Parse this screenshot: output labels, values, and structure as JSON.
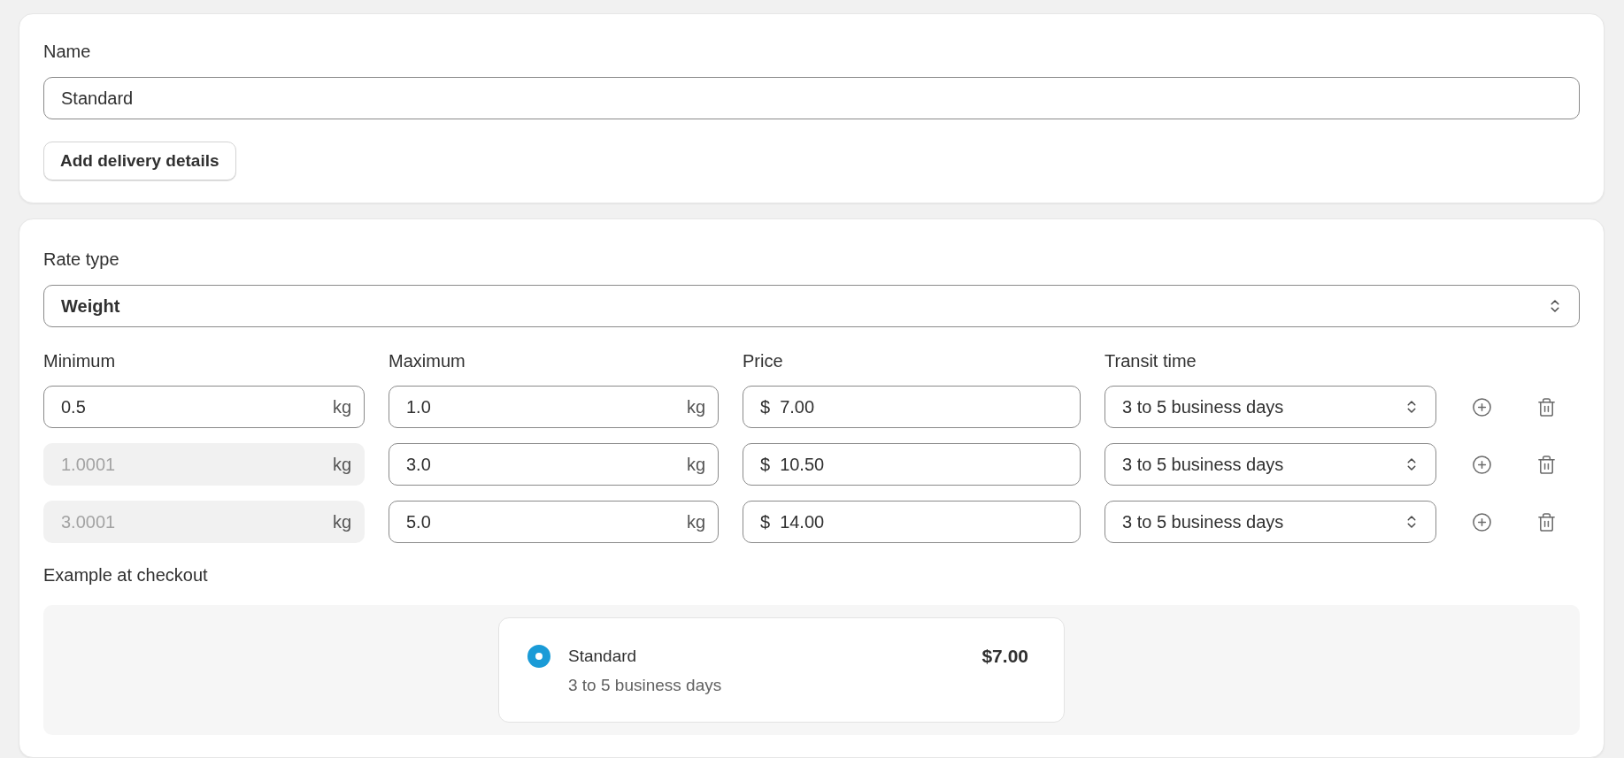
{
  "name_section": {
    "label": "Name",
    "value": "Standard",
    "button": "Add delivery details"
  },
  "rate_section": {
    "label": "Rate type",
    "value": "Weight",
    "columns": [
      "Minimum",
      "Maximum",
      "Price",
      "Transit time"
    ],
    "rows": [
      {
        "minimum": {
          "value": "0.5",
          "unit": "kg",
          "disabled": false
        },
        "maximum": {
          "value": "1.0",
          "unit": "kg"
        },
        "price": {
          "currency": "$",
          "value": "7.00"
        },
        "transit": "3 to 5 business days"
      },
      {
        "minimum": {
          "value": "1.0001",
          "unit": "kg",
          "disabled": true
        },
        "maximum": {
          "value": "3.0",
          "unit": "kg"
        },
        "price": {
          "currency": "$",
          "value": "10.50"
        },
        "transit": "3 to 5 business days"
      },
      {
        "minimum": {
          "value": "3.0001",
          "unit": "kg",
          "disabled": true
        },
        "maximum": {
          "value": "5.0",
          "unit": "kg"
        },
        "price": {
          "currency": "$",
          "value": "14.00"
        },
        "transit": "3 to 5 business days"
      }
    ]
  },
  "checkout_example": {
    "label": "Example at checkout",
    "option": {
      "name": "Standard",
      "detail": "3 to 5 business days",
      "price": "$7.00",
      "selected": true
    }
  }
}
